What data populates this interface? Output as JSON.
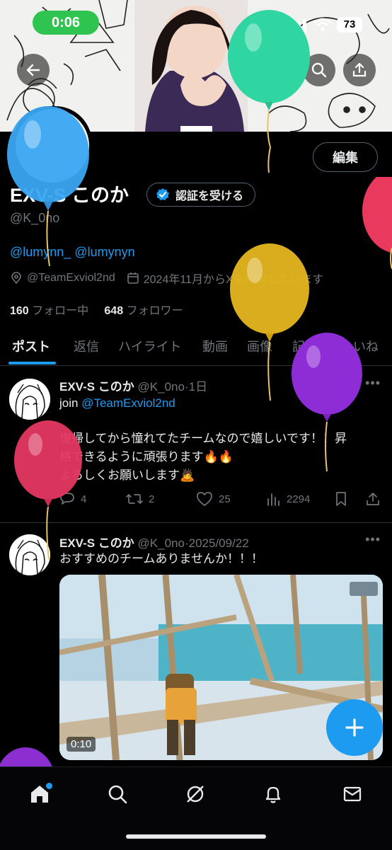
{
  "status_bar": {
    "time": "0:06",
    "battery": "73"
  },
  "profile": {
    "edit_label": "編集",
    "display_name": "EXV-S このか",
    "verify_label": "認証を受ける",
    "handle": "@K_0no",
    "bio_link_1": "@lumynn_",
    "bio_link_2": "@lumynyn",
    "team_affiliation": "@TeamExviol2nd",
    "joined": "2024年11月からXを利用しています",
    "following_count": "160",
    "following_label": "フォロー中",
    "followers_count": "648",
    "followers_label": "フォロワー"
  },
  "tabs": [
    "ポスト",
    "返信",
    "ハイライト",
    "動画",
    "画像",
    "記事",
    "いいね"
  ],
  "posts": [
    {
      "name": "EXV-S このか",
      "handle": "@K_0no",
      "sep": "·",
      "time": "1日",
      "text_prefix": "join ",
      "text_link": "@TeamExviol2nd",
      "line2": "復帰してから憧れてたチームなので嬉しいです！！昇",
      "line3": "格できるように頑張ります🔥🔥",
      "line4": "よろしくお願いします🙇",
      "replies": "4",
      "reposts": "2",
      "likes": "25",
      "views": "2294"
    },
    {
      "name": "EXV-S このか",
      "handle": "@K_0no",
      "sep": "·",
      "time": "2025/09/22",
      "text": "おすすめのチームありませんか！！！",
      "video_duration": "0:10"
    }
  ],
  "colors": {
    "accent": "#1d9bf0",
    "background": "#000000",
    "muted": "#71767b",
    "status_pill": "#2fc44f"
  },
  "icons": [
    "back-arrow-icon",
    "grok-icon",
    "search-icon",
    "share-icon",
    "verified-badge-icon",
    "location-icon",
    "calendar-icon",
    "more-icon",
    "reply-icon",
    "repost-icon",
    "like-icon",
    "views-icon",
    "bookmark-icon",
    "plus-icon",
    "home-icon",
    "explore-icon",
    "grok-nav-icon",
    "notifications-icon",
    "messages-icon"
  ]
}
